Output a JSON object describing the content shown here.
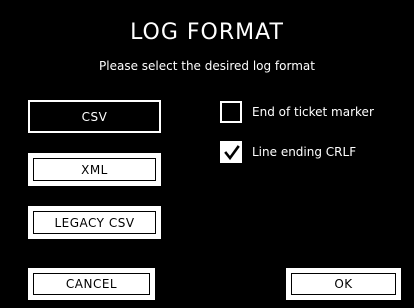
{
  "dialog": {
    "title": "LOG FORMAT",
    "subtitle": "Please select the desired log format"
  },
  "formats": [
    {
      "label": "CSV",
      "selected": true
    },
    {
      "label": "XML",
      "selected": false
    },
    {
      "label": "LEGACY CSV",
      "selected": false
    }
  ],
  "options": [
    {
      "label": "End of ticket marker",
      "checked": false,
      "icon": "checkbox-empty-icon"
    },
    {
      "label": "Line ending CRLF",
      "checked": true,
      "icon": "checkmark-icon"
    }
  ],
  "actions": {
    "cancel_label": "CANCEL",
    "ok_label": "OK"
  },
  "colors": {
    "background": "#000000",
    "foreground": "#ffffff"
  }
}
